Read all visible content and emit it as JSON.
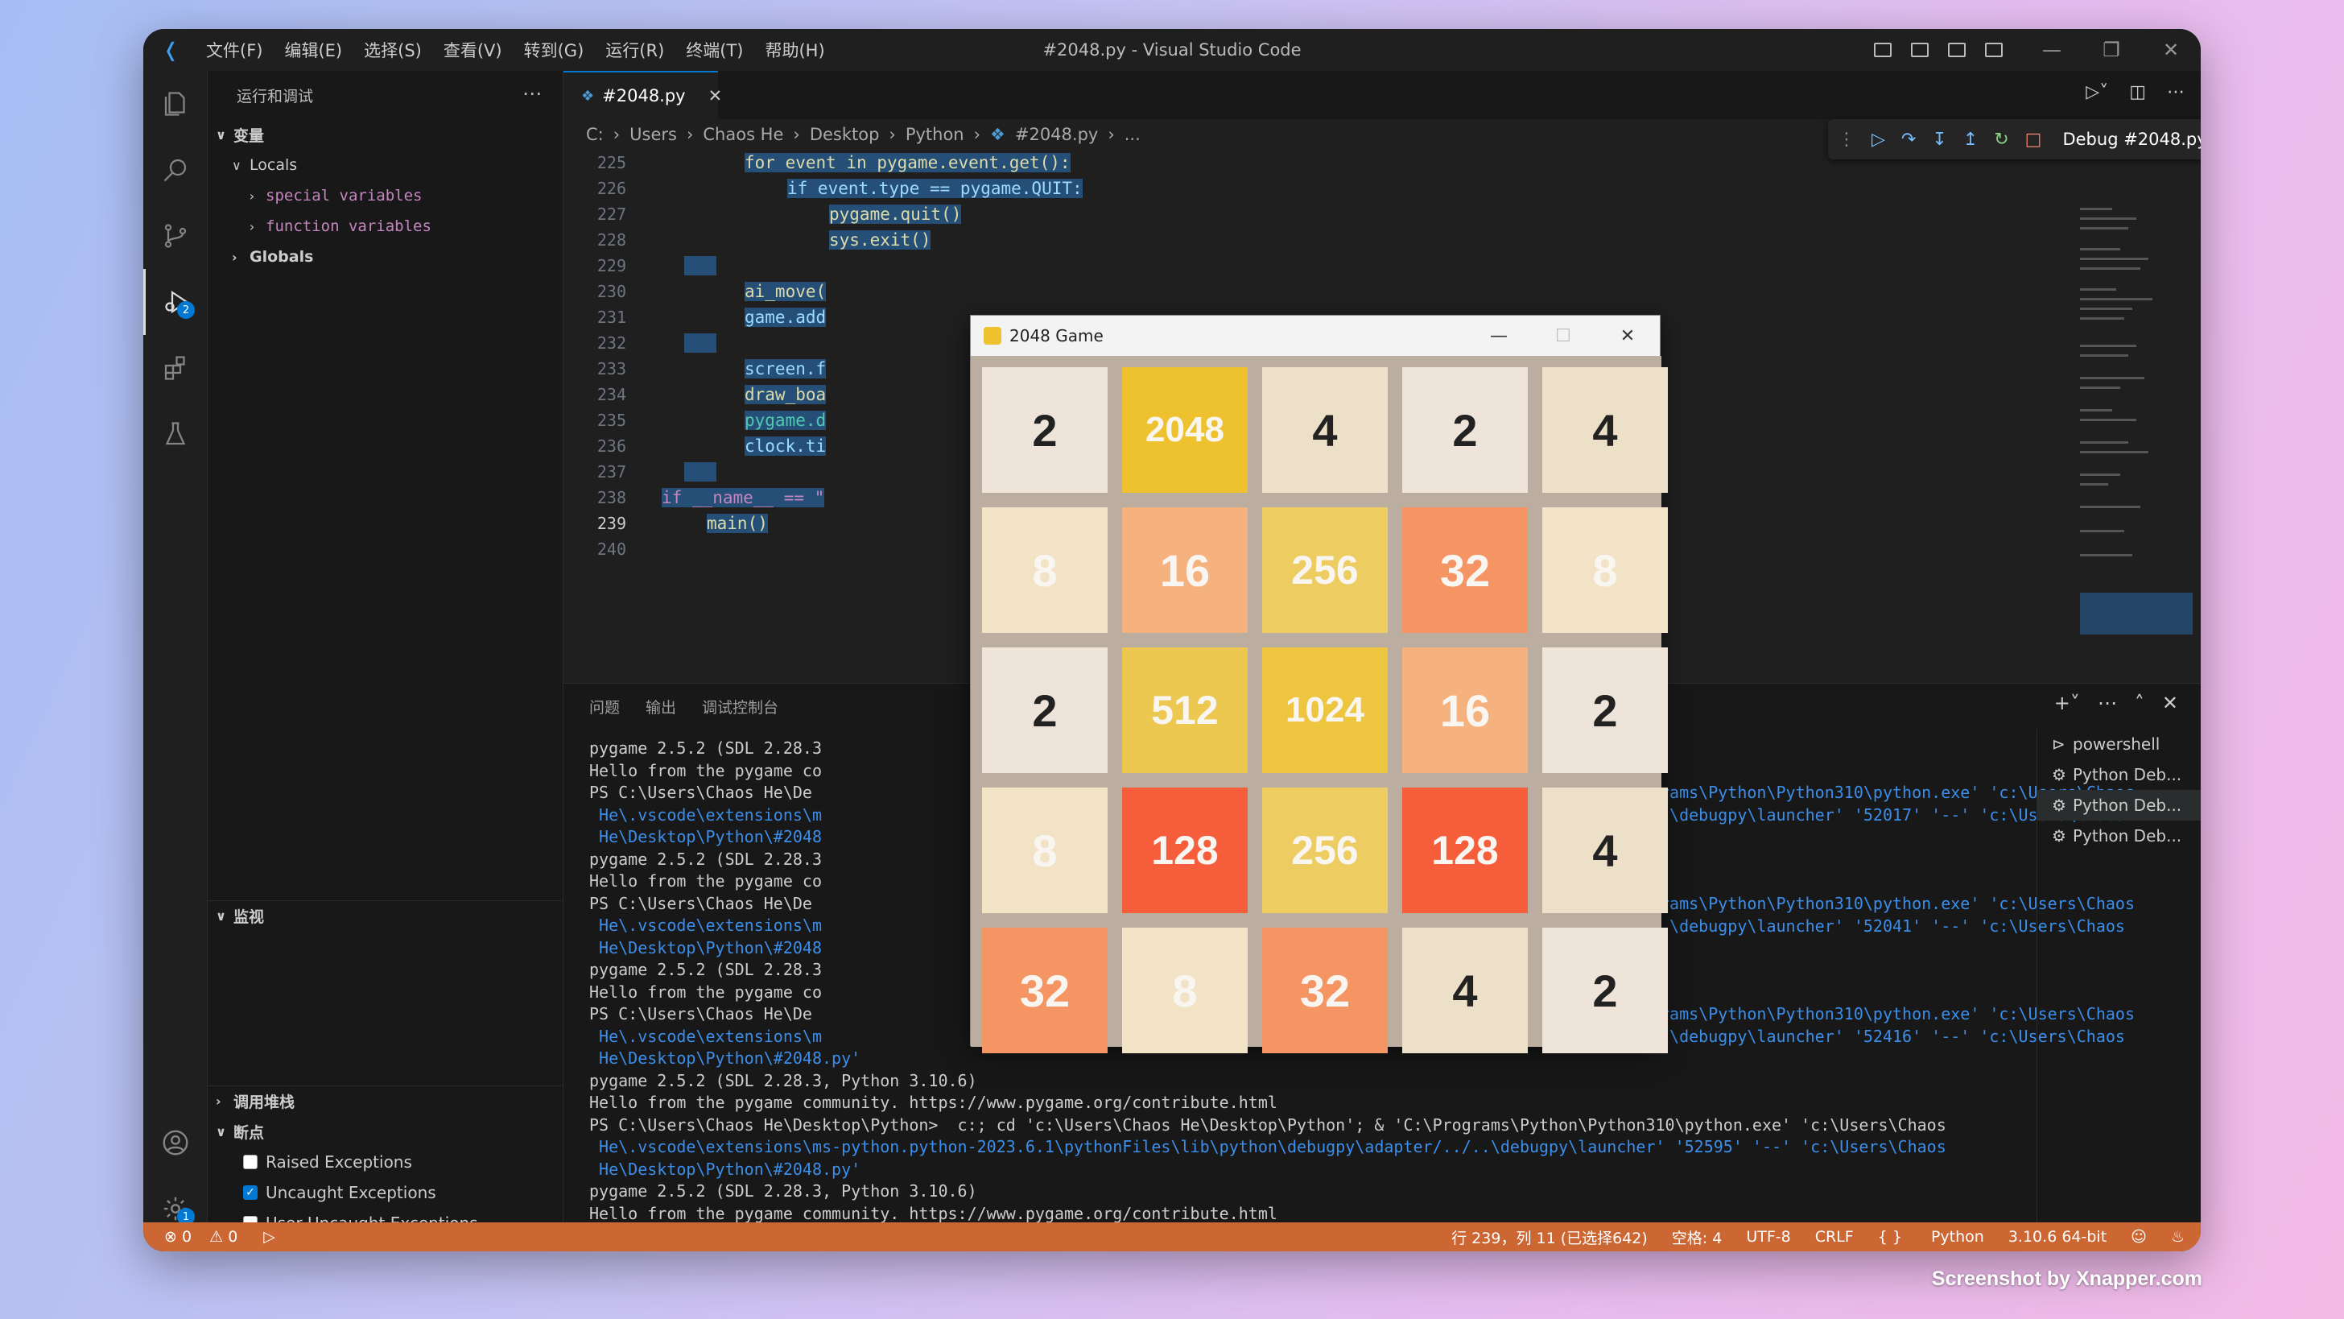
{
  "titlebar": {
    "menus": [
      "文件(F)",
      "编辑(E)",
      "选择(S)",
      "查看(V)",
      "转到(G)",
      "运行(R)",
      "终端(T)",
      "帮助(H)"
    ],
    "window_title": "#2048.py - Visual Studio Code"
  },
  "activity_bar": {
    "debug_badge": "2",
    "settings_badge": "1"
  },
  "sidebar": {
    "header": "运行和调试",
    "variables_label": "变量",
    "locals_label": "Locals",
    "special_vars": "special variables",
    "function_vars": "function variables",
    "globals_label": "Globals",
    "watch_label": "监视",
    "callstack_label": "调用堆栈",
    "breakpoints_label": "断点",
    "breakpoints": [
      {
        "label": "Raised Exceptions",
        "checked": false
      },
      {
        "label": "Uncaught Exceptions",
        "checked": true
      },
      {
        "label": "User Uncaught Exceptions",
        "checked": false
      }
    ]
  },
  "editor": {
    "tab_label": "#2048.py",
    "breadcrumb": [
      "C:",
      "Users",
      "Chaos He",
      "Desktop",
      "Python",
      "#2048.py",
      "..."
    ],
    "debug_config": "Debug #2048.py",
    "line_numbers": [
      "225",
      "226",
      "227",
      "228",
      "229",
      "230",
      "231",
      "232",
      "233",
      "234",
      "235",
      "236",
      "237",
      "238",
      "239",
      "240"
    ],
    "code": {
      "l225": "for event in pygame.event.get():",
      "l226": "if event.type == pygame.QUIT:",
      "l227": "pygame.quit()",
      "l228": "sys.exit()",
      "l230": "ai_move(",
      "l231": "game.add",
      "l233": "screen.f",
      "l234": "draw_boa",
      "l235": "pygame.d",
      "l236": "clock.ti",
      "l238": "if __name__ == \"",
      "l239": "main()"
    }
  },
  "panel": {
    "tabs": [
      "问题",
      "输出",
      "调试控制台"
    ],
    "terminal_lines": [
      "pygame 2.5.2 (SDL 2.28.3",
      "Hello from the pygame co",
      "PS C:\\Users\\Chaos He\\De",
      " He\\.vscode\\extensions\\m",
      " He\\Desktop\\Python\\#2048",
      "pygame 2.5.2 (SDL 2.28.3",
      "Hello from the pygame co",
      "PS C:\\Users\\Chaos He\\De",
      " He\\.vscode\\extensions\\m",
      " He\\Desktop\\Python\\#2048",
      "pygame 2.5.2 (SDL 2.28.3",
      "Hello from the pygame co",
      "PS C:\\Users\\Chaos He\\De",
      " He\\.vscode\\extensions\\m",
      " He\\Desktop\\Python\\#2048.py'",
      "pygame 2.5.2 (SDL 2.28.3, Python 3.10.6)",
      "Hello from the pygame community. https://www.pygame.org/contribute.html",
      "PS C:\\Users\\Chaos He\\Desktop\\Python>  c:; cd 'c:\\Users\\Chaos He\\Desktop\\Python'; & 'C:\\Programs\\Python\\Python310\\python.exe' 'c:\\Users\\Chaos",
      " He\\.vscode\\extensions\\ms-python.python-2023.6.1\\pythonFiles\\lib\\python\\debugpy\\adapter/../..\\debugpy\\launcher' '52595' '--' 'c:\\Users\\Chaos",
      " He\\Desktop\\Python\\#2048.py'",
      "pygame 2.5.2 (SDL 2.28.3, Python 3.10.6)",
      "Hello from the pygame community. https://www.pygame.org/contribute.html"
    ],
    "terminal_right": [
      "rams\\Python\\Python310\\python.exe' 'c:\\Users\\Chaos",
      ".\\debugpy\\launcher' '52017' '--' 'c:\\Users\\Chaos",
      "rams\\Python\\Python310\\python.exe' 'c:\\Users\\Chaos",
      ".\\debugpy\\launcher' '52041' '--' 'c:\\Users\\Chaos",
      "rams\\Python\\Python310\\python.exe' 'c:\\Users\\Chaos",
      ".\\debugpy\\launcher' '52416' '--' 'c:\\Users\\Chaos"
    ],
    "terminals": [
      "powershell",
      "Python Deb...",
      "Python Deb...",
      "Python Deb..."
    ]
  },
  "statusbar": {
    "errors": "0",
    "warnings": "0",
    "position": "行 239，列 11 (已选择642)",
    "spaces": "空格: 4",
    "encoding": "UTF-8",
    "eol": "CRLF",
    "language": "Python",
    "interpreter": "3.10.6 64-bit",
    "color": "#cc6633"
  },
  "game": {
    "title": "2048 Game",
    "board": [
      [
        2,
        2048,
        4,
        2,
        4
      ],
      [
        8,
        16,
        256,
        32,
        8
      ],
      [
        2,
        512,
        1024,
        16,
        2
      ],
      [
        8,
        128,
        256,
        128,
        4
      ],
      [
        32,
        8,
        32,
        4,
        2
      ]
    ]
  },
  "credit": "Screenshot by Xnapper.com"
}
